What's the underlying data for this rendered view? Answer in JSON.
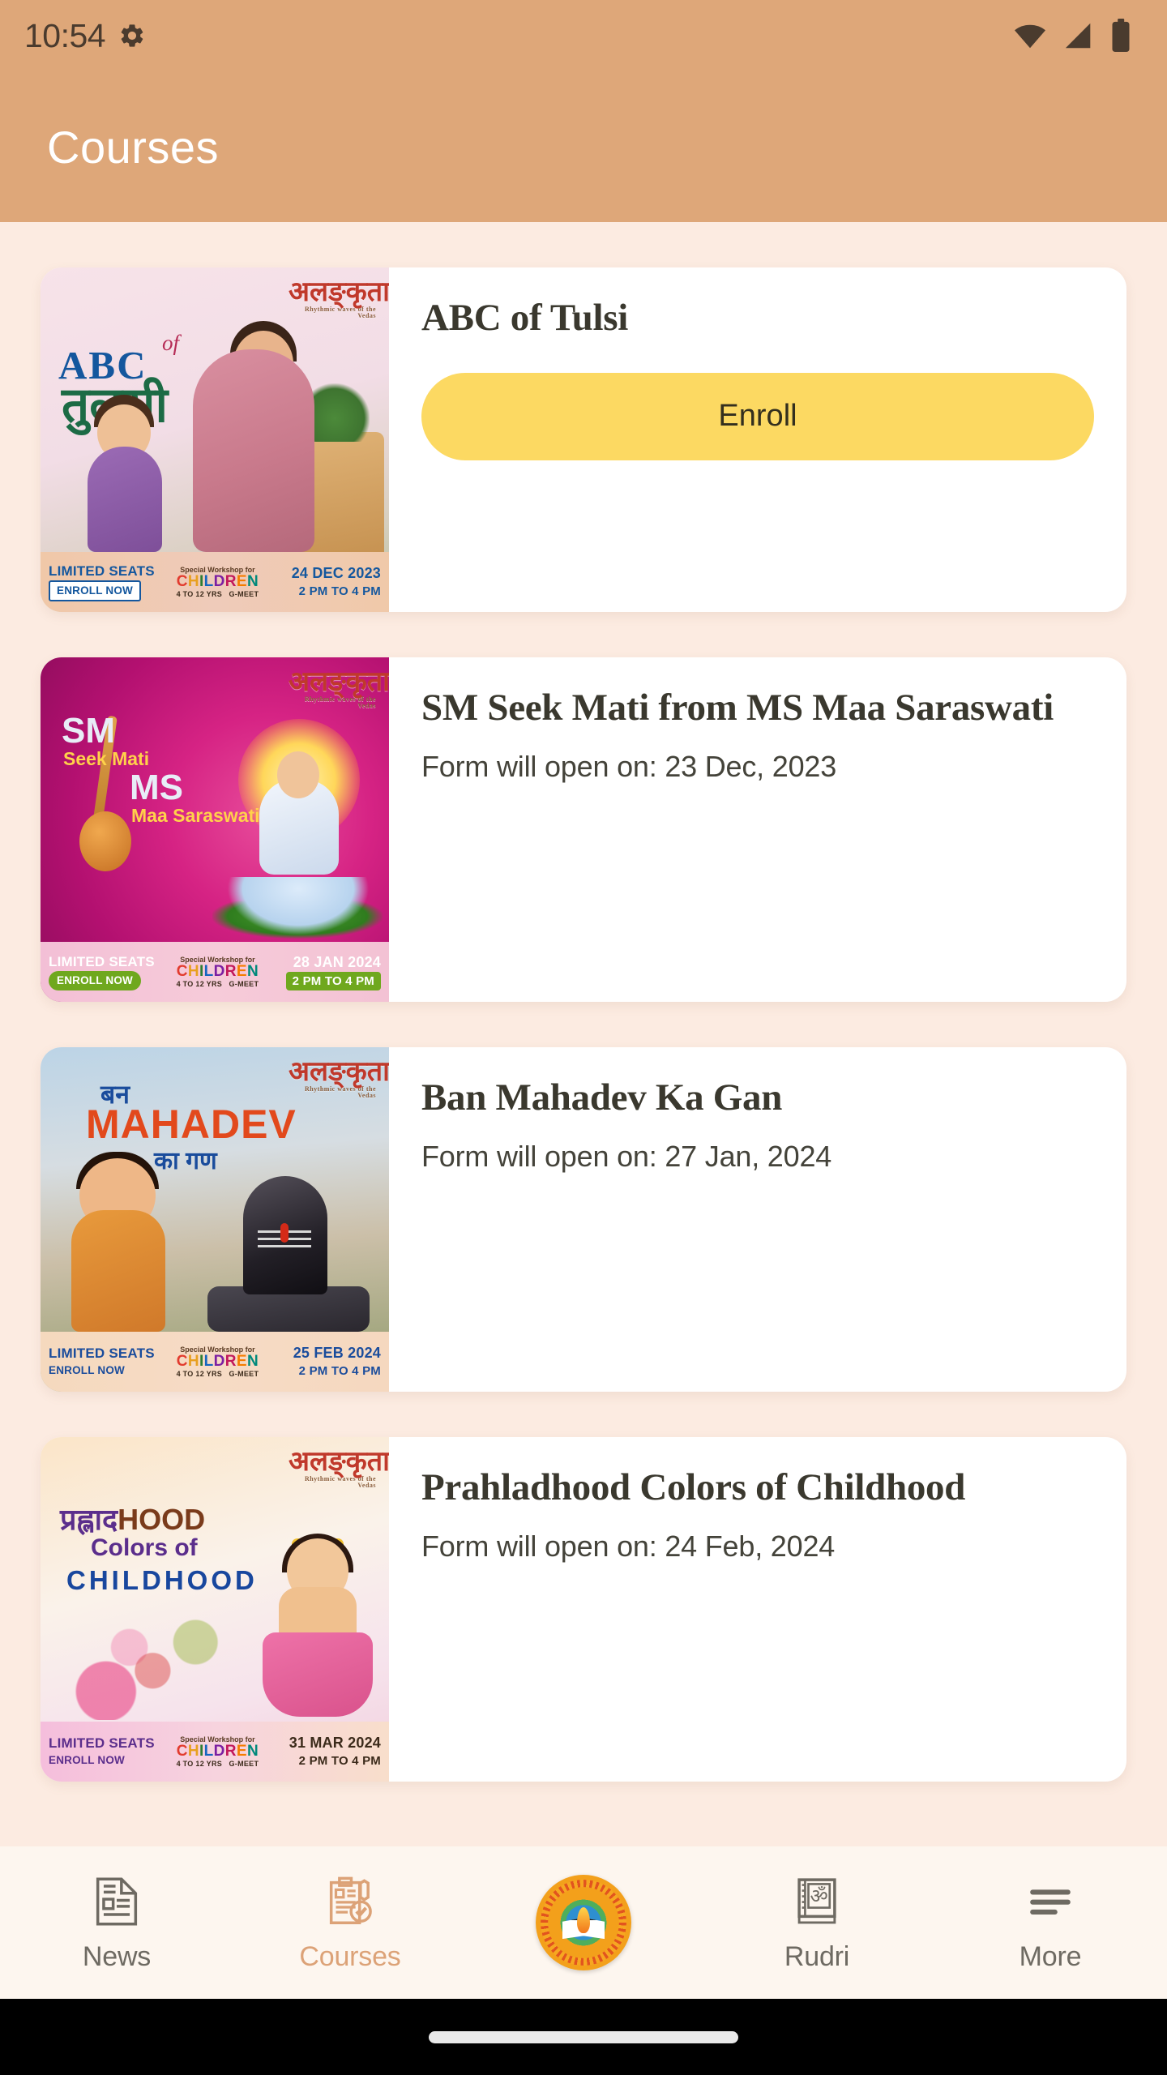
{
  "status_bar": {
    "time": "10:54",
    "icons": [
      "gear-icon",
      "wifi-icon",
      "cellular-signal-icon",
      "battery-icon"
    ]
  },
  "app_bar": {
    "title": "Courses",
    "background_color": "#DEA779",
    "title_color": "#FFFFFF"
  },
  "theme": {
    "page_background": "#FCEBE1",
    "card_background": "#FFFFFF",
    "accent": "#DCA277",
    "enroll_button": "#FCD962",
    "nav_background": "#FDF6EF",
    "nav_inactive_text": "#6E6A62",
    "title_text": "#3A382E"
  },
  "courses": [
    {
      "title": "ABC of Tulsi",
      "subtitle": "",
      "action_label": "Enroll",
      "has_enroll_button": true,
      "poster": {
        "headline_latin": "ABC",
        "headline_of": "of",
        "headline_devanagari": "तुलसी",
        "brand": "अलङ्कृता",
        "brand_tagline": "Rhythmic waves of the Vedas",
        "limited_seats": "LIMITED SEATS",
        "enroll_now": "ENROLL  NOW",
        "workshop_for": "Special Workshop for",
        "children": "CHILDREN",
        "age_range": "4 TO 12 YRS",
        "platform": "G-MEET",
        "date": "24 DEC 2023",
        "time": "2 PM TO 4 PM"
      }
    },
    {
      "title": "SM Seek Mati from MS Maa Saraswati",
      "subtitle": "Form will open on: 23 Dec, 2023",
      "action_label": "",
      "has_enroll_button": false,
      "poster": {
        "headline_latin": "SM",
        "headline_sub1": "Seek Mati",
        "headline_latin2": "MS",
        "headline_sub2": "Maa Saraswati",
        "brand": "अलङ्कृता",
        "brand_tagline": "Rhythmic waves of the Vedas",
        "limited_seats": "LIMITED SEATS",
        "enroll_now": "ENROLL  NOW",
        "workshop_for": "Special Workshop for",
        "children": "CHILDREN",
        "age_range": "4 TO 12 YRS",
        "platform": "G-MEET",
        "date": "28 JAN 2024",
        "time": "2 PM TO 4 PM"
      }
    },
    {
      "title": "Ban Mahadev Ka Gan",
      "subtitle": "Form will open on: 27 Jan, 2024",
      "action_label": "",
      "has_enroll_button": false,
      "poster": {
        "headline_pre": "बन",
        "headline_latin": "MAHADEV",
        "headline_post": "का गण",
        "brand": "अलङ्कृता",
        "brand_tagline": "Rhythmic waves of the Vedas",
        "limited_seats": "LIMITED SEATS",
        "enroll_now": "ENROLL  NOW",
        "workshop_for": "Special Workshop for",
        "children": "CHILDREN",
        "age_range": "4 TO 12 YRS",
        "platform": "G-MEET",
        "date": "25 FEB 2024",
        "time": "2 PM TO 4 PM"
      }
    },
    {
      "title": "Prahladhood Colors of Childhood",
      "subtitle": "Form will open on: 24 Feb, 2024",
      "action_label": "",
      "has_enroll_button": false,
      "poster": {
        "headline_pre": "प्रह्लाद",
        "headline_latin": "HOOD",
        "headline_mid": "Colors of",
        "headline_post": "CHILDHOOD",
        "brand": "अलङ्कृता",
        "brand_tagline": "Rhythmic waves of the Vedas",
        "limited_seats": "LIMITED SEATS",
        "enroll_now": "ENROLL  NOW",
        "workshop_for": "Special Workshop for",
        "children": "CHILDREN",
        "age_range": "4 TO 12 YRS",
        "platform": "G-MEET",
        "date": "31 MAR 2024",
        "time": "2 PM TO 4 PM"
      }
    }
  ],
  "bottom_nav": {
    "items": [
      {
        "label": "News",
        "icon": "news-document-icon",
        "active": false
      },
      {
        "label": "Courses",
        "icon": "clipboard-check-icon",
        "active": true
      },
      {
        "label": "",
        "icon": "app-logo-emblem-icon",
        "active": false
      },
      {
        "label": "Rudri",
        "icon": "book-om-icon",
        "active": false
      },
      {
        "label": "More",
        "icon": "hamburger-menu-icon",
        "active": false
      }
    ]
  }
}
